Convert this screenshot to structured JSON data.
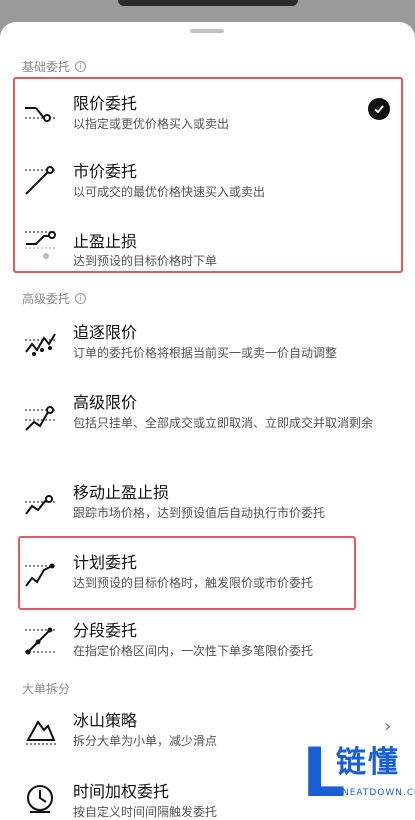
{
  "sections": {
    "basic": "基础委托",
    "advanced": "高级委托",
    "split": "大单拆分"
  },
  "info_icon": "i",
  "items": {
    "limit": {
      "title": "限价委托",
      "desc": "以指定或更优价格买入或卖出",
      "selected": true
    },
    "market": {
      "title": "市价委托",
      "desc": "以可成交的最优价格快速买入或卖出"
    },
    "tpsl": {
      "title": "止盈止损",
      "desc": "达到预设的目标价格时下单"
    },
    "chase": {
      "title": "追逐限价",
      "desc": "订单的委托价格将根据当前买一或卖一价自动调整"
    },
    "adv_limit": {
      "title": "高级限价",
      "desc": "包括只挂单、全部成交或立即取消、立即成交并取消剩余"
    },
    "trailing": {
      "title": "移动止盈止损",
      "desc": "跟踪市场价格，达到预设值后自动执行市价委托"
    },
    "plan": {
      "title": "计划委托",
      "desc": "达到预设的目标价格时，触发限价或市价委托"
    },
    "tiered": {
      "title": "分段委托",
      "desc": "在指定价格区间内，一次性下单多笔限价委托"
    },
    "iceberg": {
      "title": "冰山策略",
      "desc": "拆分大单为小单，减少滑点"
    },
    "twap": {
      "title": "时间加权委托",
      "desc": "按自定义时间间隔触发委托"
    }
  },
  "icons": {
    "check": "checkmark-icon",
    "chevron": "chevron-right-icon"
  },
  "chevron_glyph": "›",
  "highlight_color": "#e35a5f",
  "watermark": {
    "letter": "L",
    "cn": "链懂",
    "en": "NEATDOWN.COM"
  }
}
